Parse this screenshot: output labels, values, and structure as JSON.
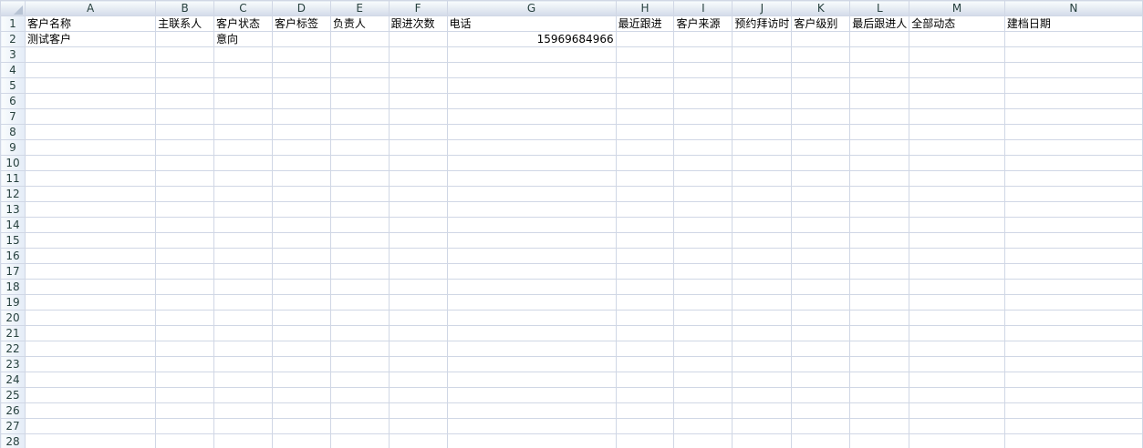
{
  "columns": [
    "A",
    "B",
    "C",
    "D",
    "E",
    "F",
    "G",
    "H",
    "I",
    "J",
    "K",
    "L",
    "M",
    "N"
  ],
  "row_numbers": [
    "1",
    "2",
    "3",
    "4",
    "5",
    "6",
    "7",
    "8",
    "9",
    "10",
    "11",
    "12",
    "13",
    "14",
    "15",
    "16",
    "17",
    "18",
    "19",
    "20",
    "21",
    "22",
    "23",
    "24",
    "25",
    "26",
    "27",
    "28"
  ],
  "headers": [
    "客户名称",
    "主联系人",
    "客户状态",
    "客户标签",
    "负责人",
    "跟进次数",
    "电话",
    "最近跟进",
    "客户来源",
    "预约拜访时",
    "客户级别",
    "最后跟进人",
    "全部动态",
    "建档日期"
  ],
  "data_row": [
    "测试客户",
    "",
    "意向",
    "",
    "",
    "",
    "15969684966",
    "",
    "",
    "",
    "",
    "",
    "",
    ""
  ],
  "colors": {
    "grid_line": "#d0d7e5",
    "header_border": "#9eb6ce",
    "header_text": "#27413e"
  }
}
